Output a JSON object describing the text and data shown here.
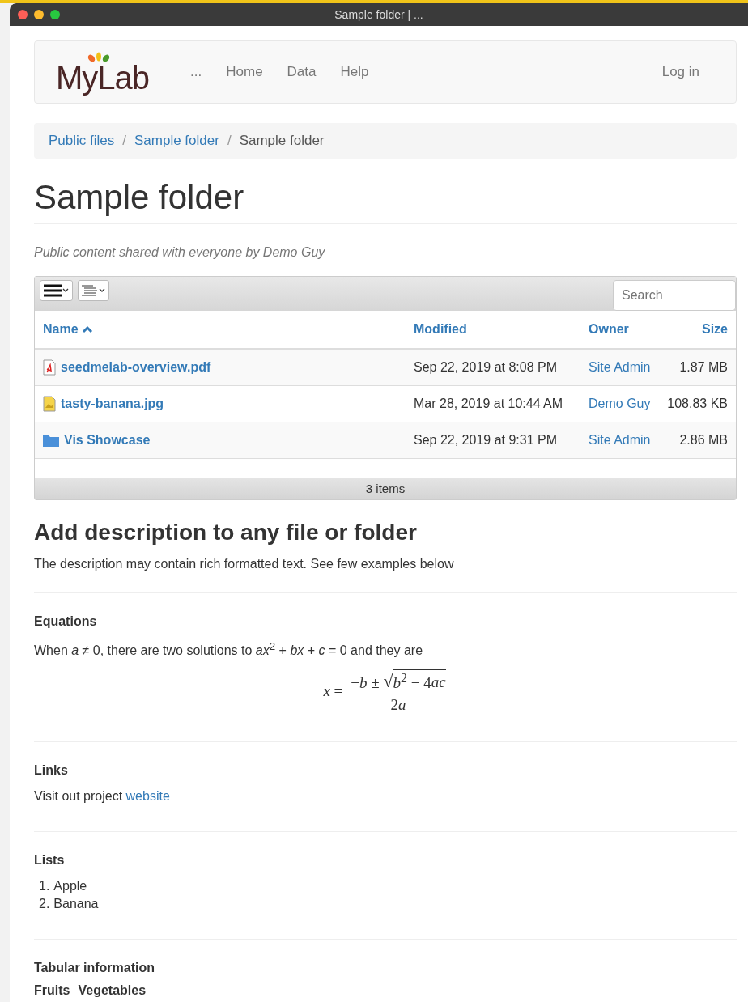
{
  "window": {
    "title": "Sample folder | ..."
  },
  "navbar": {
    "brand": "MyLab",
    "items": [
      {
        "label": "..."
      },
      {
        "label": "Home"
      },
      {
        "label": "Data"
      },
      {
        "label": "Help"
      }
    ],
    "login": "Log in"
  },
  "breadcrumb": [
    {
      "label": "Public files",
      "link": true
    },
    {
      "separator": "/",
      "label": "Sample folder",
      "link": true
    },
    {
      "separator": "/",
      "label": "Sample folder",
      "link": false
    }
  ],
  "page_title": "Sample folder",
  "subtitle": "Public content shared with everyone by Demo Guy",
  "file_grid": {
    "search": {
      "placeholder": "Search"
    },
    "columns": [
      {
        "label": "Name",
        "sorted": true
      },
      {
        "label": "Modified",
        "sorted": false
      },
      {
        "label": "Owner",
        "sorted": false
      },
      {
        "label": "Size",
        "sorted": false
      }
    ],
    "rows": [
      {
        "kind": "pdf",
        "name": "seedmelab-overview.pdf",
        "modified": "Sep 22, 2019 at 8:08 PM",
        "owner": "Site Admin",
        "size": "1.87 MB"
      },
      {
        "kind": "image",
        "name": "tasty-banana.jpg",
        "modified": "Mar 28, 2019 at 10:44 AM",
        "owner": "Demo Guy",
        "size": "108.83 KB"
      },
      {
        "kind": "folder",
        "name": "Vis Showcase",
        "modified": "Sep 22, 2019 at 9:31 PM",
        "owner": "Site Admin",
        "size": "2.86 MB"
      }
    ],
    "footer": "3 items"
  },
  "description": {
    "heading": "Add description to any file or folder",
    "intro": "The description may contain rich formatted text. See few examples below",
    "sections": [
      {
        "kind": "equation",
        "heading": "Equations",
        "text": "When *a* ≠ 0, there are two solutions to *ax*$^{2}$ + *bx* + *c* = 0 and they are",
        "formula": {
          "lhs": "*x* =",
          "numerator": "−*b* ±",
          "radical": "√",
          "radicand": "*b*$^{2}$ − 4",
          "radicand_var": "ac",
          "denominator": "2",
          "denominator_var": "a"
        }
      },
      {
        "kind": "link",
        "heading": "Links",
        "text": "Visit out project",
        "link": "website"
      },
      {
        "kind": "list",
        "heading": "Lists",
        "items": [
          {
            "marker": "1.",
            "label": "Apple"
          },
          {
            "marker": "2.",
            "label": "Banana"
          }
        ]
      },
      {
        "kind": "table",
        "heading": "Tabular information",
        "columns": [
          "Fruits",
          "Vegetables"
        ]
      }
    ]
  }
}
